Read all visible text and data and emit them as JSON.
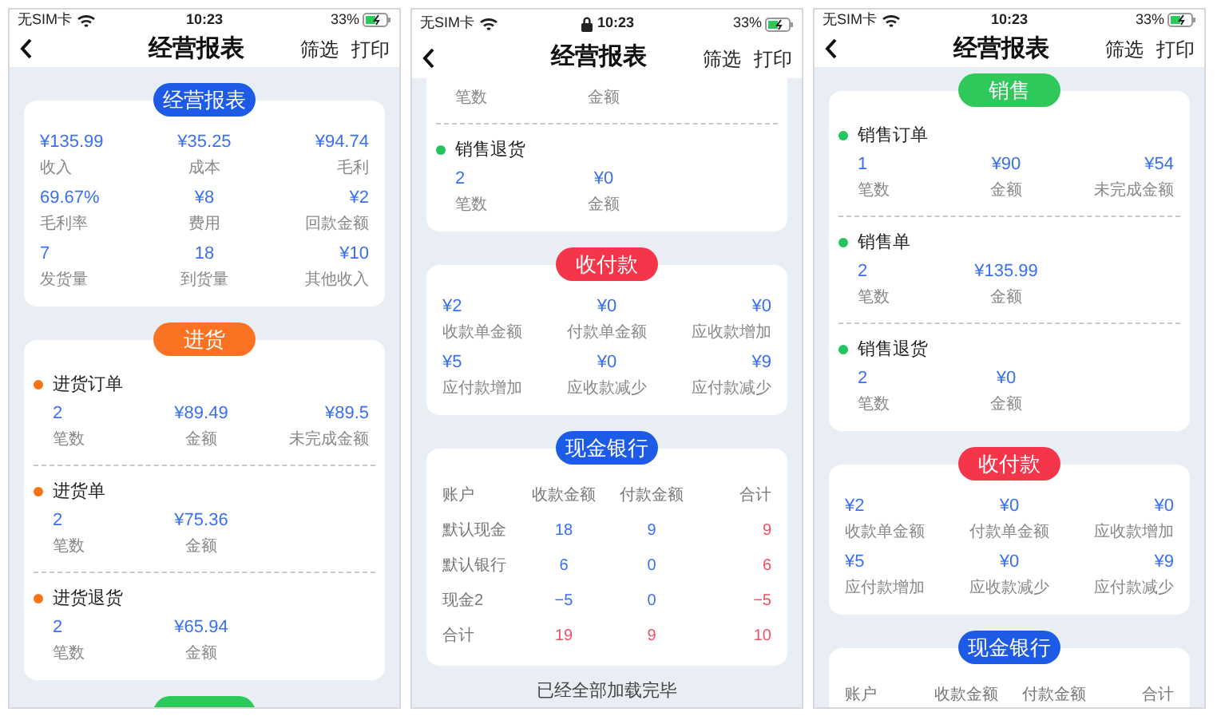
{
  "phones": [
    {
      "status": {
        "carrier": "无SIM卡",
        "time": "10:23",
        "battery": "33%",
        "locked": false
      },
      "nav": {
        "title": "经营报表",
        "actions": [
          "筛选",
          "打印"
        ]
      },
      "sections": [
        {
          "kind": "metrics",
          "badge": {
            "label": "经营报表",
            "color": "#1d5be6"
          },
          "rows": [
            [
              {
                "value": "¥135.99",
                "label": "收入"
              },
              {
                "value": "¥35.25",
                "label": "成本"
              },
              {
                "value": "¥94.74",
                "label": "毛利"
              }
            ],
            [
              {
                "value": "69.67%",
                "label": "毛利率"
              },
              {
                "value": "¥8",
                "label": "费用"
              },
              {
                "value": "¥2",
                "label": "回款金额"
              }
            ],
            [
              {
                "value": "7",
                "label": "发货量"
              },
              {
                "value": "18",
                "label": "到货量"
              },
              {
                "value": "¥10",
                "label": "其他收入"
              }
            ]
          ]
        },
        {
          "kind": "groups",
          "badge": {
            "label": "进货",
            "color": "#fb7223"
          },
          "groups": [
            {
              "title": "进货订单",
              "color": "#f97316",
              "cells": [
                {
                  "value": "2",
                  "label": "笔数"
                },
                {
                  "value": "¥89.49",
                  "label": "金额"
                },
                {
                  "value": "¥89.5",
                  "label": "未完成金额"
                }
              ]
            },
            {
              "title": "进货单",
              "color": "#f97316",
              "cells": [
                {
                  "value": "2",
                  "label": "笔数"
                },
                {
                  "value": "¥75.36",
                  "label": "金额"
                }
              ]
            },
            {
              "title": "进货退货",
              "color": "#f97316",
              "cells": [
                {
                  "value": "2",
                  "label": "笔数"
                },
                {
                  "value": "¥65.94",
                  "label": "金额"
                }
              ]
            }
          ]
        },
        {
          "kind": "groups",
          "badge": {
            "color": "#2fc85a"
          }
        }
      ]
    },
    {
      "status": {
        "carrier": "无SIM卡",
        "time": "10:23",
        "battery": "33%",
        "locked": true
      },
      "nav": {
        "title": "经营报表",
        "actions": [
          "筛选",
          "打印"
        ]
      },
      "sections": [
        {
          "kind": "groups",
          "cut_top": true,
          "groups": [
            {
              "cells": [
                {
                  "label": "笔数"
                },
                {
                  "label": "金额"
                }
              ]
            },
            {
              "title": "销售退货",
              "color": "#22c55e",
              "cells": [
                {
                  "value": "2",
                  "label": "笔数"
                },
                {
                  "value": "¥0",
                  "label": "金额"
                }
              ]
            }
          ]
        },
        {
          "kind": "metrics",
          "badge": {
            "label": "收付款",
            "color": "#f5364a"
          },
          "rows": [
            [
              {
                "value": "¥2",
                "label": "收款单金额"
              },
              {
                "value": "¥0",
                "label": "付款单金额"
              },
              {
                "value": "¥0",
                "label": "应收款增加"
              }
            ],
            [
              {
                "value": "¥5",
                "label": "应付款增加"
              },
              {
                "value": "¥0",
                "label": "应收款减少"
              },
              {
                "value": "¥9",
                "label": "应付款减少"
              }
            ]
          ]
        },
        {
          "kind": "table",
          "badge": {
            "label": "现金银行",
            "color": "#1d5be6"
          },
          "columns": [
            {
              "label": "账户",
              "color": "#777777"
            },
            {
              "label": "收款金额",
              "color": "#3a6ff2"
            },
            {
              "label": "付款金额",
              "color": "#3a6ff2"
            },
            {
              "label": "合计",
              "color": "#f0505f"
            }
          ],
          "rows": [
            {
              "kind": "normal",
              "cells": [
                "默认现金",
                "18",
                "9",
                "9"
              ]
            },
            {
              "kind": "normal",
              "cells": [
                "默认银行",
                "6",
                "0",
                "6"
              ]
            },
            {
              "kind": "normal",
              "cells": [
                "现金2",
                "−5",
                "0",
                "−5"
              ]
            },
            {
              "kind": "total",
              "cells": [
                "合计",
                "19",
                "9",
                "10"
              ]
            }
          ]
        }
      ],
      "footer": "已经全部加载完毕"
    },
    {
      "status": {
        "carrier": "无SIM卡",
        "time": "10:23",
        "battery": "33%",
        "locked": false
      },
      "nav": {
        "title": "经营报表",
        "actions": [
          "筛选",
          "打印"
        ]
      },
      "sections": [
        {
          "kind": "groups",
          "badge": {
            "label": "销售",
            "color": "#2fc85a"
          },
          "groups": [
            {
              "title": "销售订单",
              "color": "#22c55e",
              "cells": [
                {
                  "value": "1",
                  "label": "笔数"
                },
                {
                  "value": "¥90",
                  "label": "金额"
                },
                {
                  "value": "¥54",
                  "label": "未完成金额"
                }
              ]
            },
            {
              "title": "销售单",
              "color": "#22c55e",
              "cells": [
                {
                  "value": "2",
                  "label": "笔数"
                },
                {
                  "value": "¥135.99",
                  "label": "金额"
                }
              ]
            },
            {
              "title": "销售退货",
              "color": "#22c55e",
              "cells": [
                {
                  "value": "2",
                  "label": "笔数"
                },
                {
                  "value": "¥0",
                  "label": "金额"
                }
              ]
            }
          ]
        },
        {
          "kind": "metrics",
          "badge": {
            "label": "收付款",
            "color": "#f5364a"
          },
          "rows": [
            [
              {
                "value": "¥2",
                "label": "收款单金额"
              },
              {
                "value": "¥0",
                "label": "付款单金额"
              },
              {
                "value": "¥0",
                "label": "应收款增加"
              }
            ],
            [
              {
                "value": "¥5",
                "label": "应付款增加"
              },
              {
                "value": "¥0",
                "label": "应收款减少"
              },
              {
                "value": "¥9",
                "label": "应付款减少"
              }
            ]
          ]
        },
        {
          "kind": "table",
          "badge": {
            "label": "现金银行",
            "color": "#1d5be6"
          },
          "columns": [
            {
              "label": "账户"
            },
            {
              "label": "收款金额"
            },
            {
              "label": "付款金额"
            },
            {
              "label": "合计"
            }
          ]
        }
      ]
    }
  ]
}
